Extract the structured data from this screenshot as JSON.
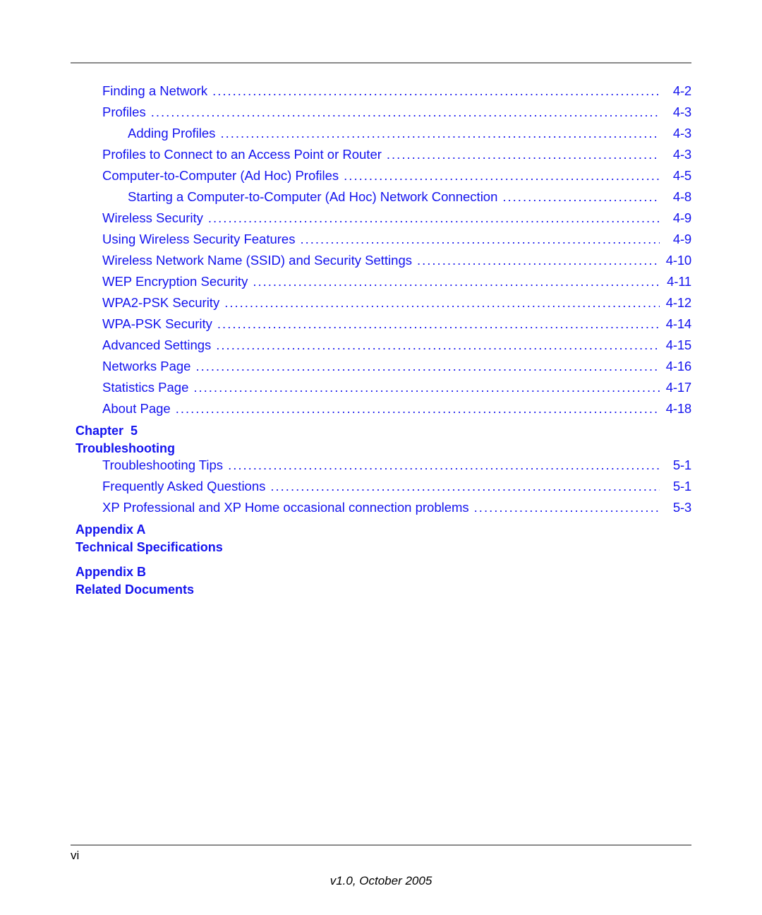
{
  "document": {
    "folio": "vi",
    "version_line": "v1.0, October 2005",
    "text_color": "#1414ee",
    "rule_color": "#8a8a8a"
  },
  "toc": {
    "entries": [
      {
        "label": "Finding a Network",
        "page": "4-2",
        "level": 1
      },
      {
        "label": "Profiles",
        "page": "4-3",
        "level": 1
      },
      {
        "label": "Adding Profiles",
        "page": "4-3",
        "level": 2
      },
      {
        "label": "Profiles to Connect to an Access Point or Router",
        "page": "4-3",
        "level": 1
      },
      {
        "label": "Computer-to-Computer (Ad Hoc) Profiles",
        "page": "4-5",
        "level": 1
      },
      {
        "label": "Starting a Computer-to-Computer (Ad Hoc) Network Connection",
        "page": "4-8",
        "level": 2
      },
      {
        "label": "Wireless Security",
        "page": "4-9",
        "level": 1
      },
      {
        "label": "Using Wireless Security Features",
        "page": "4-9",
        "level": 1
      },
      {
        "label": "Wireless Network Name (SSID) and Security Settings",
        "page": "4-10",
        "level": 1
      },
      {
        "label": "WEP Encryption Security",
        "page": "4-11",
        "level": 1
      },
      {
        "label": "WPA2-PSK Security",
        "page": "4-12",
        "level": 1
      },
      {
        "label": "WPA-PSK Security",
        "page": "4-14",
        "level": 1
      },
      {
        "label": "Advanced Settings",
        "page": "4-15",
        "level": 1
      },
      {
        "label": "Networks Page",
        "page": "4-16",
        "level": 1
      },
      {
        "label": "Statistics Page",
        "page": "4-17",
        "level": 1
      },
      {
        "label": "About Page",
        "page": "4-18",
        "level": 1
      }
    ]
  },
  "chapter5": {
    "number_line": "Chapter  5",
    "title_line": "Troubleshooting",
    "entries": [
      {
        "label": "Troubleshooting Tips",
        "page": "5-1",
        "level": 1
      },
      {
        "label": "Frequently Asked Questions",
        "page": "5-1",
        "level": 1
      },
      {
        "label": "XP Professional and XP Home occasional connection problems",
        "page": "5-3",
        "level": 1
      }
    ]
  },
  "appendix_a": {
    "number_line": "Appendix A",
    "title_line": "Technical Specifications"
  },
  "appendix_b": {
    "number_line": "Appendix B",
    "title_line": "Related Documents"
  }
}
